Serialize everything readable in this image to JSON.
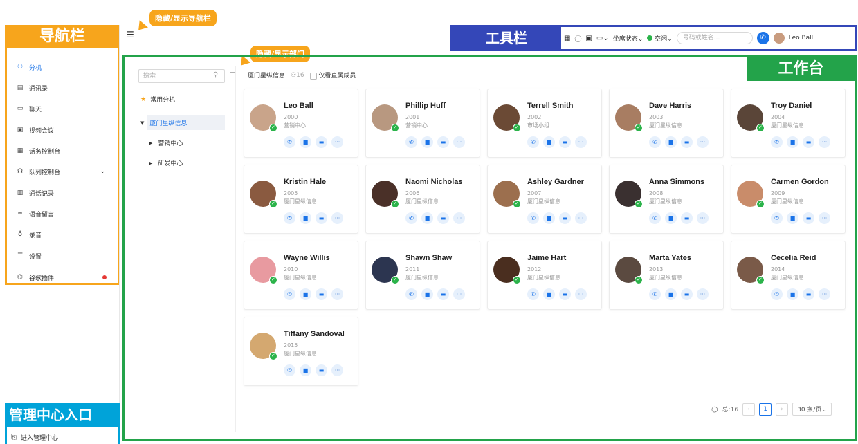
{
  "annotations": {
    "toggle_nav": "隐藏/显示导航栏",
    "toggle_dept": "隐藏/显示部门",
    "nav_label": "导航栏",
    "toolbar_label": "工具栏",
    "workspace_label": "工作台",
    "admin_label": "管理中心入口"
  },
  "colors": {
    "nav": "#f7a51c",
    "toolbar": "#3447b8",
    "workspace": "#23a34a",
    "admin": "#00a3d9",
    "accent": "#1a73e8",
    "online": "#2bb34a"
  },
  "nav": {
    "items": [
      {
        "label": "分机",
        "icon": "extension-icon"
      },
      {
        "label": "通讯录",
        "icon": "contacts-icon"
      },
      {
        "label": "聊天",
        "icon": "chat-icon"
      },
      {
        "label": "视频会议",
        "icon": "video-conference-icon"
      },
      {
        "label": "话务控制台",
        "icon": "operator-console-icon"
      },
      {
        "label": "队列控制台",
        "icon": "queue-console-icon"
      },
      {
        "label": "通话记录",
        "icon": "call-log-icon"
      },
      {
        "label": "语音留言",
        "icon": "voicemail-icon"
      },
      {
        "label": "录音",
        "icon": "recording-icon"
      },
      {
        "label": "设置",
        "icon": "settings-icon"
      },
      {
        "label": "谷歌插件",
        "icon": "plugin-icon"
      }
    ],
    "admin_entry": "进入管理中心"
  },
  "toolbar": {
    "agent_status": "坐席状态",
    "presence": "空闲",
    "search_placeholder": "号码或姓名...",
    "user_name": "Leo Ball"
  },
  "departments": {
    "search_placeholder": "搜索",
    "favorites": "常用分机",
    "root": "厦门星纵信息",
    "children": [
      "营销中心",
      "研发中心"
    ]
  },
  "header": {
    "dept_name": "厦门星纵信息",
    "member_count": "16",
    "direct_only": "仅看直属成员"
  },
  "contacts": [
    {
      "name": "Leo Ball",
      "ext": "2000",
      "dept": "营销中心",
      "avatar": "#c9a48a"
    },
    {
      "name": "Phillip Huff",
      "ext": "2001",
      "dept": "营销中心",
      "avatar": "#b89880"
    },
    {
      "name": "Terrell Smith",
      "ext": "2002",
      "dept": "市场小组",
      "avatar": "#6b4a35"
    },
    {
      "name": "Dave Harris",
      "ext": "2003",
      "dept": "厦门星纵信息",
      "avatar": "#a87d62"
    },
    {
      "name": "Troy Daniel",
      "ext": "2004",
      "dept": "厦门星纵信息",
      "avatar": "#5a4538"
    },
    {
      "name": "Kristin Hale",
      "ext": "2005",
      "dept": "厦门星纵信息",
      "avatar": "#8a5a40"
    },
    {
      "name": "Naomi Nicholas",
      "ext": "2006",
      "dept": "厦门星纵信息",
      "avatar": "#4a3028"
    },
    {
      "name": "Ashley Gardner",
      "ext": "2007",
      "dept": "厦门星纵信息",
      "avatar": "#9c6f4e"
    },
    {
      "name": "Anna Simmons",
      "ext": "2008",
      "dept": "厦门星纵信息",
      "avatar": "#3a3030"
    },
    {
      "name": "Carmen Gordon",
      "ext": "2009",
      "dept": "厦门星纵信息",
      "avatar": "#c98c6a"
    },
    {
      "name": "Wayne Willis",
      "ext": "2010",
      "dept": "厦门星纵信息",
      "avatar": "#e89aa0"
    },
    {
      "name": "Shawn Shaw",
      "ext": "2011",
      "dept": "厦门星纵信息",
      "avatar": "#2c3550"
    },
    {
      "name": "Jaime Hart",
      "ext": "2012",
      "dept": "厦门星纵信息",
      "avatar": "#4a2e1f"
    },
    {
      "name": "Marta Yates",
      "ext": "2013",
      "dept": "厦门星纵信息",
      "avatar": "#5b4a40"
    },
    {
      "name": "Cecelia Reid",
      "ext": "2014",
      "dept": "厦门星纵信息",
      "avatar": "#7a5a48"
    },
    {
      "name": "Tiffany Sandoval",
      "ext": "2015",
      "dept": "厦门星纵信息",
      "avatar": "#d4a870"
    }
  ],
  "pager": {
    "total": "总:16",
    "current": "1",
    "page_size": "30 条/页"
  }
}
